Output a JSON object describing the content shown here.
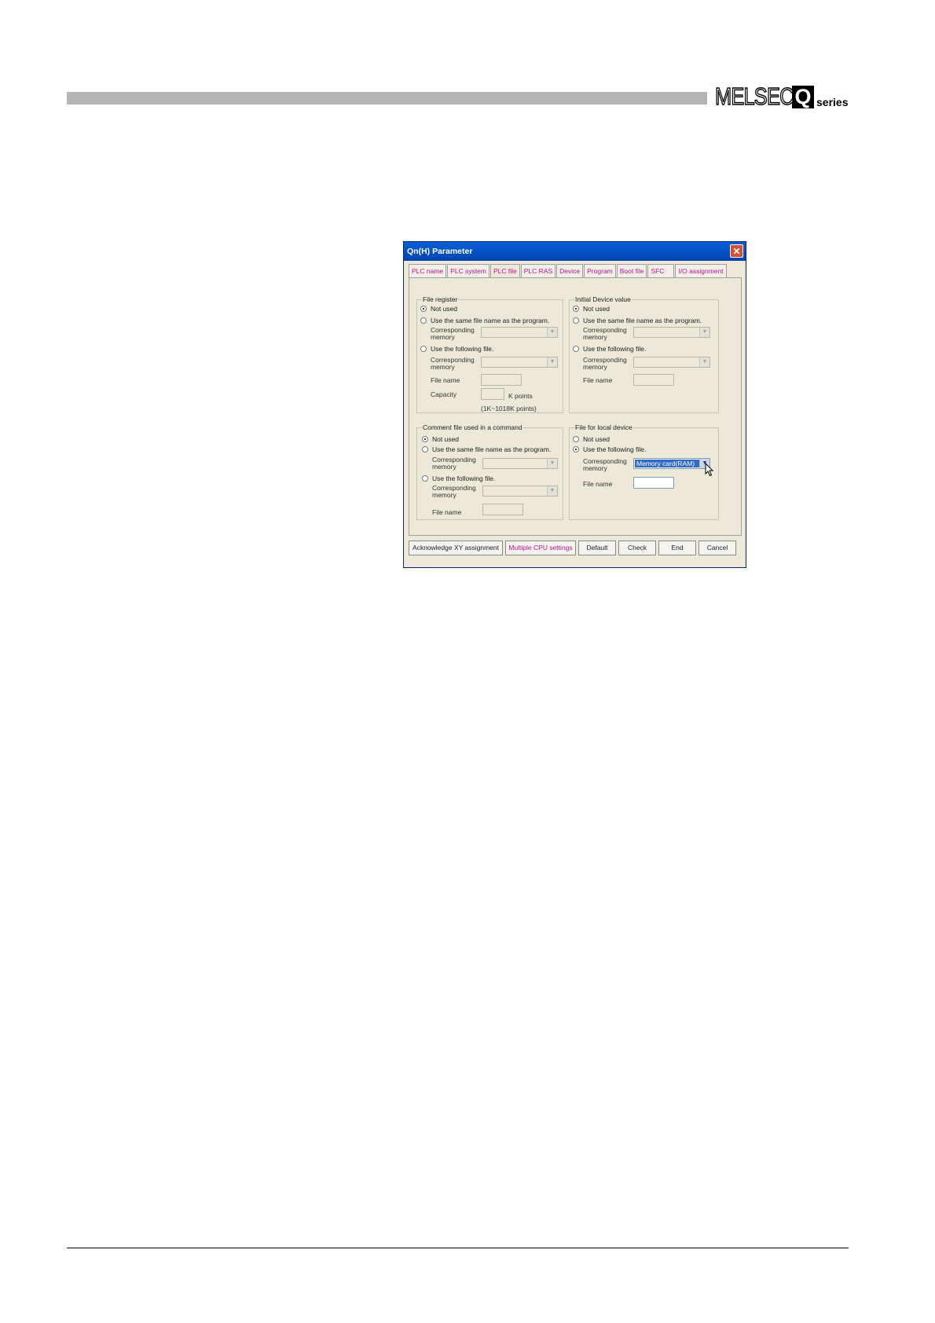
{
  "header": {
    "logo": {
      "brand": "MELSEC",
      "letter": "Q",
      "suffix": "series"
    }
  },
  "dialog": {
    "title": "Qn(H) Parameter",
    "close_icon": "close-icon",
    "tabs": [
      "PLC name",
      "PLC system",
      "PLC file",
      "PLC RAS",
      "Device",
      "Program",
      "Boot file",
      "SFC",
      "I/O assignment"
    ],
    "active_tab": "PLC file",
    "file_register": {
      "title": "File register",
      "not_used": "Not used",
      "same_name": "Use the same file name as the program.",
      "corresponding_memory": "Corresponding memory",
      "following_file": "Use the following file.",
      "corresponding_memory_2": "Corresponding memory",
      "file_name": "File name",
      "capacity": "Capacity",
      "k_points": "K points",
      "range": "(1K~1018K points)"
    },
    "initial_device": {
      "title": "Initial Device value",
      "not_used": "Not used",
      "same_name": "Use the same file name as the program.",
      "corresponding_memory": "Corresponding memory",
      "following_file": "Use the following file.",
      "corresponding_memory_2": "Corresponding memory",
      "file_name": "File name"
    },
    "comment_file": {
      "title": "Comment file used in a command",
      "not_used": "Not used",
      "same_name": "Use the same file name as the program.",
      "corresponding_memory": "Corresponding memory",
      "following_file": "Use the following file.",
      "corresponding_memory_2": "Corresponding memory",
      "file_name": "File name"
    },
    "local_device": {
      "title": "File for local device",
      "not_used": "Not used",
      "following_file": "Use the following file.",
      "corresponding_memory": "Corresponding memory",
      "memory_value": "Memory card(RAM)",
      "file_name": "File name"
    },
    "buttons": {
      "acknowledge": "Acknowledge XY assignment",
      "multiple_cpu": "Multiple CPU settings",
      "default": "Default",
      "check": "Check",
      "end": "End",
      "cancel": "Cancel"
    }
  }
}
